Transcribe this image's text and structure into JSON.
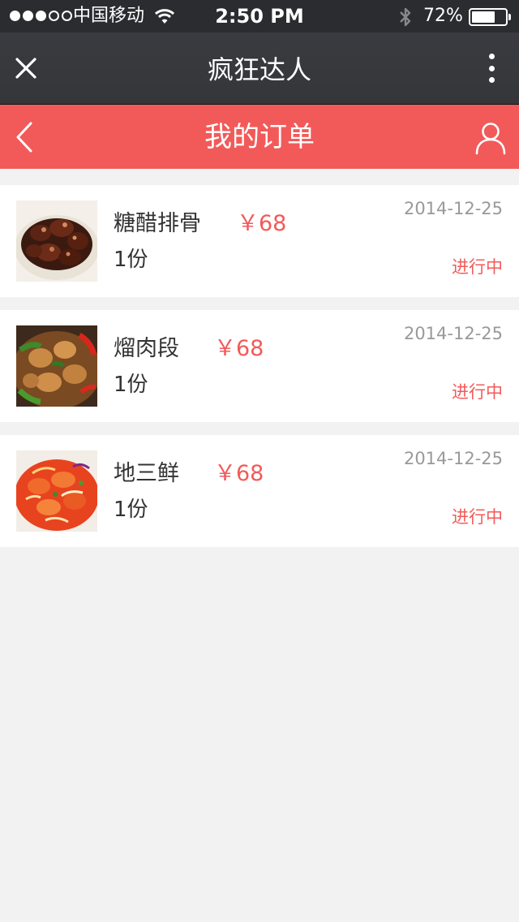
{
  "status_bar": {
    "carrier": "中国移动",
    "time": "2:50 PM",
    "battery": "72%",
    "battery_level": 0.72,
    "signal_bars_filled": 3,
    "signal_bars_total": 5
  },
  "wechat_bar": {
    "title": "疯狂达人",
    "close_icon": "close-icon",
    "more_icon": "more-vertical-icon"
  },
  "nav": {
    "title": "我的订单",
    "back_icon": "chevron-left-icon",
    "user_icon": "user-icon"
  },
  "colors": {
    "accent": "#f25a59",
    "status_bar_bg": "#2b2c30",
    "wechat_bar_bg": "#38393d",
    "page_bg": "#f2f2f2"
  },
  "orders": [
    {
      "name": "糖醋排骨",
      "price": "￥68",
      "quantity": "1份",
      "date": "2014-12-25",
      "status": "进行中",
      "image": "sweet-and-sour-ribs"
    },
    {
      "name": "熘肉段",
      "price": "￥68",
      "quantity": "1份",
      "date": "2014-12-25",
      "status": "进行中",
      "image": "fried-pork-with-peppers"
    },
    {
      "name": "地三鲜",
      "price": "￥68",
      "quantity": "1份",
      "date": "2014-12-25",
      "status": "进行中",
      "image": "sweet-and-sour-dish"
    }
  ]
}
